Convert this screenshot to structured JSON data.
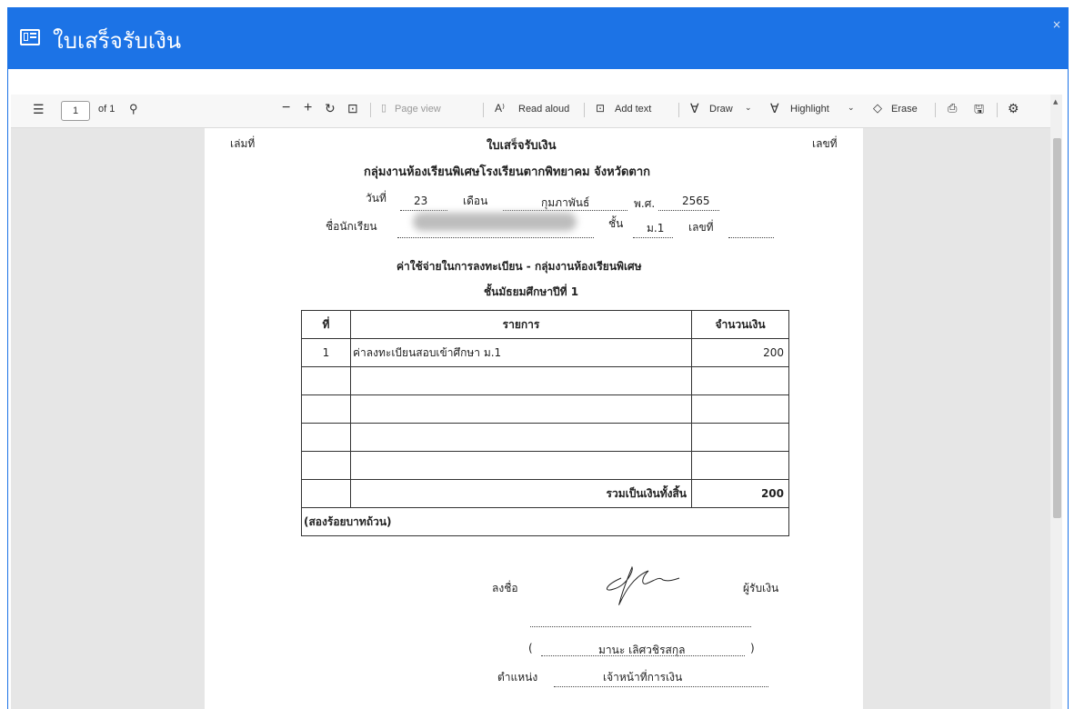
{
  "window": {
    "title": "ใบเสร็จรับเงิน",
    "close_symbol": "×"
  },
  "toolbar": {
    "page_number": "1",
    "page_of": "of 1",
    "page_view": "Page view",
    "read_aloud": "Read aloud",
    "add_text": "Add text",
    "draw": "Draw",
    "highlight": "Highlight",
    "erase": "Erase"
  },
  "receipt": {
    "book_label": "เล่มที่",
    "number_label": "เลขที่",
    "title": "ใบเสร็จรับเงิน",
    "org": "กลุ่มงานห้องเรียนพิเศษโรงเรียนตากพิทยาคม จังหวัดตาก",
    "day_label": "วันที่",
    "day": "23",
    "month_label": "เดือน",
    "month": "กุมภาพันธ์",
    "year_label": "พ.ศ.",
    "year": "2565",
    "student_label": "ชื่อนักเรียน",
    "class_label": "ชั้น",
    "class_value": "ม.1",
    "student_no_label": "เลขที่",
    "heading": "ค่าใช้จ่ายในการลงทะเบียน - กลุ่มงานห้องเรียนพิเศษ",
    "subheading": "ชั้นมัธยมศึกษาปีที่ 1",
    "table": {
      "headers": [
        "ที่",
        "รายการ",
        "จำนวนเงิน"
      ],
      "rows": [
        {
          "no": "1",
          "item": "ค่าลงทะเบียนสอบเข้าศึกษา ม.1",
          "amount": "200"
        }
      ],
      "total_label": "รวมเป็นเงินทั้งสิ้น",
      "total": "200",
      "amount_words": "(สองร้อยบาทถ้วน)"
    },
    "sign_label": "ลงชื่อ",
    "receiver_label": "ผู้รับเงิน",
    "paren_open": "(",
    "signer_name": "มานะ เลิศวชิรสกุล",
    "paren_close": ")",
    "position_label": "ตำแหน่ง",
    "position": "เจ้าหน้าที่การเงิน"
  }
}
